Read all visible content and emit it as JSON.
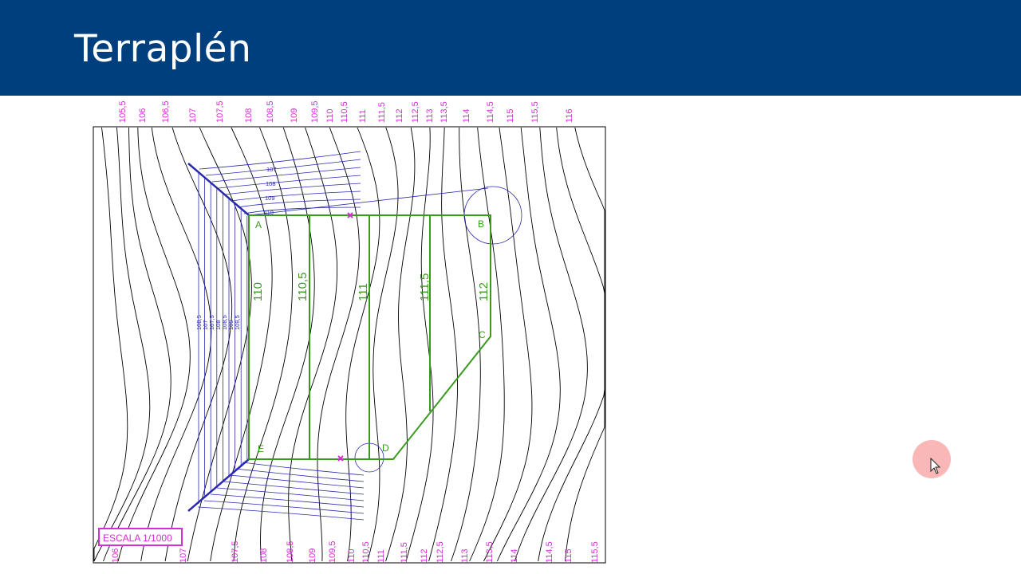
{
  "slide": {
    "title": "Terraplén"
  },
  "plan": {
    "top_contour_labels": [
      "105,5",
      "106",
      "106,5",
      "107",
      "107,5",
      "108",
      "108,5",
      "109",
      "109,5",
      "110",
      "110,5",
      "111",
      "111,5",
      "112",
      "112,5",
      "113",
      "113,5",
      "114",
      "114,5",
      "115",
      "115,5",
      "116"
    ],
    "bottom_contour_labels": [
      "106",
      "107",
      "107,5",
      "108",
      "108,5",
      "109",
      "109,5",
      "110",
      "110,5",
      "111",
      "111,5",
      "112",
      "112,5",
      "113",
      "113,5",
      "114",
      "114,5",
      "115",
      "115,5"
    ],
    "platform_level_labels": [
      "110",
      "110,5",
      "111",
      "111,5",
      "112"
    ],
    "vertex_labels": {
      "a": "A",
      "b": "B",
      "c": "C",
      "d": "D",
      "e": "E"
    },
    "slope_labels_left": [
      "108,5",
      "107",
      "107,5",
      "108",
      "108,5",
      "109",
      "109,5"
    ],
    "slope_labels_top": [
      "107",
      "108",
      "109",
      "110"
    ],
    "scale_label": "ESCALA 1/1000",
    "colors": {
      "contour": "#000000",
      "platform": "#3a9a1e",
      "slope": "#2a2ab0",
      "labels": "#d22ed2",
      "header": "#003f7d"
    }
  }
}
